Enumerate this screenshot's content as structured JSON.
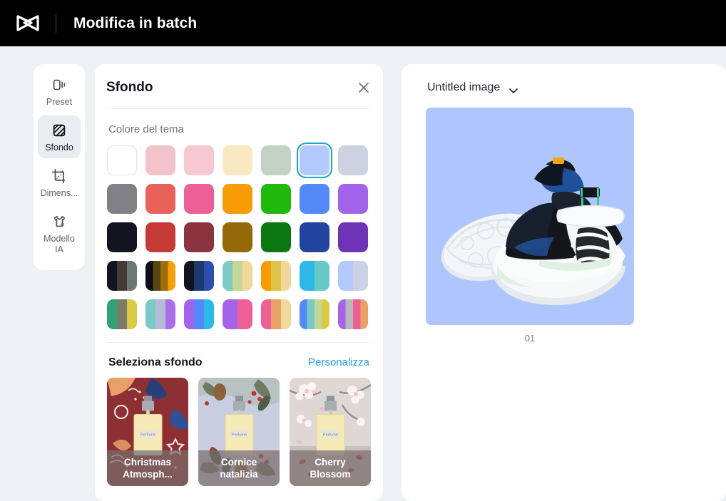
{
  "header": {
    "logo_icon": "capcut-logo-icon",
    "title": "Modifica in batch"
  },
  "sidebar": {
    "items": [
      {
        "label": "Preset",
        "icon": "preset-icon",
        "active": false
      },
      {
        "label": "Sfondo",
        "icon": "background-pattern-icon",
        "active": true
      },
      {
        "label": "Dimens...",
        "icon": "crop-resize-icon",
        "active": false
      },
      {
        "label": "Modello IA",
        "icon": "ai-model-shirt-icon",
        "active": false
      }
    ]
  },
  "panel": {
    "title": "Sfondo",
    "close_icon": "close-icon",
    "theme_color_label": "Colore del tema",
    "selected_swatch_index": 5,
    "selection_ring_color": "#1ba6c4",
    "swatch_rows": [
      [
        {
          "type": "solid",
          "color": "#ffffff",
          "bordered": true
        },
        {
          "type": "solid",
          "color": "#f2c3cb"
        },
        {
          "type": "solid",
          "color": "#f5c8d2"
        },
        {
          "type": "solid",
          "color": "#f8e9c0"
        },
        {
          "type": "solid",
          "color": "#c3d2c4"
        },
        {
          "type": "solid",
          "color": "#b3caff"
        },
        {
          "type": "solid",
          "color": "#ccd2e2"
        }
      ],
      [
        {
          "type": "solid",
          "color": "#808085"
        },
        {
          "type": "solid",
          "color": "#e8625a"
        },
        {
          "type": "solid",
          "color": "#ec6095"
        },
        {
          "type": "solid",
          "color": "#f59c07"
        },
        {
          "type": "solid",
          "color": "#1fb80c"
        },
        {
          "type": "solid",
          "color": "#5489f8"
        },
        {
          "type": "solid",
          "color": "#a363ea"
        }
      ],
      [
        {
          "type": "solid",
          "color": "#12151f"
        },
        {
          "type": "solid",
          "color": "#c63a36"
        },
        {
          "type": "solid",
          "color": "#8a343f"
        },
        {
          "type": "solid",
          "color": "#94690a"
        },
        {
          "type": "solid",
          "color": "#0a7710"
        },
        {
          "type": "solid",
          "color": "#22439e"
        },
        {
          "type": "solid",
          "color": "#6f34b5"
        }
      ],
      [
        {
          "type": "stripes",
          "colors": [
            "#12151f",
            "#463a38",
            "#6b7a71"
          ]
        },
        {
          "type": "stripes",
          "colors": [
            "#0d0f16",
            "#5a4412",
            "#9d6f07",
            "#f5a007"
          ]
        },
        {
          "type": "stripes",
          "colors": [
            "#12151f",
            "#1b3a6e",
            "#2f4fae"
          ]
        },
        {
          "type": "stripes",
          "colors": [
            "#7ecac4",
            "#c3d694",
            "#f0d79a"
          ]
        },
        {
          "type": "stripes",
          "colors": [
            "#f59c07",
            "#dfc348",
            "#f2d79c"
          ]
        },
        {
          "type": "stripes",
          "colors": [
            "#2cb8e8",
            "#68c9c9"
          ]
        },
        {
          "type": "stripes",
          "colors": [
            "#b3caff",
            "#ccd2e2"
          ]
        }
      ],
      [
        {
          "type": "stripes",
          "colors": [
            "#2fa173",
            "#7b7a68",
            "#d9ca44"
          ]
        },
        {
          "type": "stripes",
          "colors": [
            "#79cac4",
            "#b2bcd6",
            "#a96ee8"
          ]
        },
        {
          "type": "stripes",
          "colors": [
            "#a363ea",
            "#5489f8",
            "#2cb8e8"
          ]
        },
        {
          "type": "stripes",
          "colors": [
            "#a363ea",
            "#ec6095"
          ]
        },
        {
          "type": "stripes",
          "colors": [
            "#ec6095",
            "#e9a266",
            "#f0d79a"
          ]
        },
        {
          "type": "stripes",
          "colors": [
            "#5489f8",
            "#79cac4",
            "#c3d694",
            "#d9ca44"
          ]
        },
        {
          "type": "stripes",
          "colors": [
            "#a363ea",
            "#b9b6bd",
            "#ec6095",
            "#e9a266"
          ]
        }
      ]
    ],
    "select_background_label": "Seleziona sfondo",
    "customize_link": "Personalizza",
    "templates": [
      {
        "name": "Christmas Atmosph...",
        "theme": "christmas"
      },
      {
        "name": "Cornice natalizia",
        "theme": "frame"
      },
      {
        "name": "Cherry Blossom",
        "theme": "cherry"
      }
    ]
  },
  "canvas": {
    "document_name": "Untitled image",
    "dropdown_icon": "chevron-down-icon",
    "preview_background": "#aec6fd",
    "preview_caption": "01",
    "preview_subject": "sneakers-pair-image"
  }
}
